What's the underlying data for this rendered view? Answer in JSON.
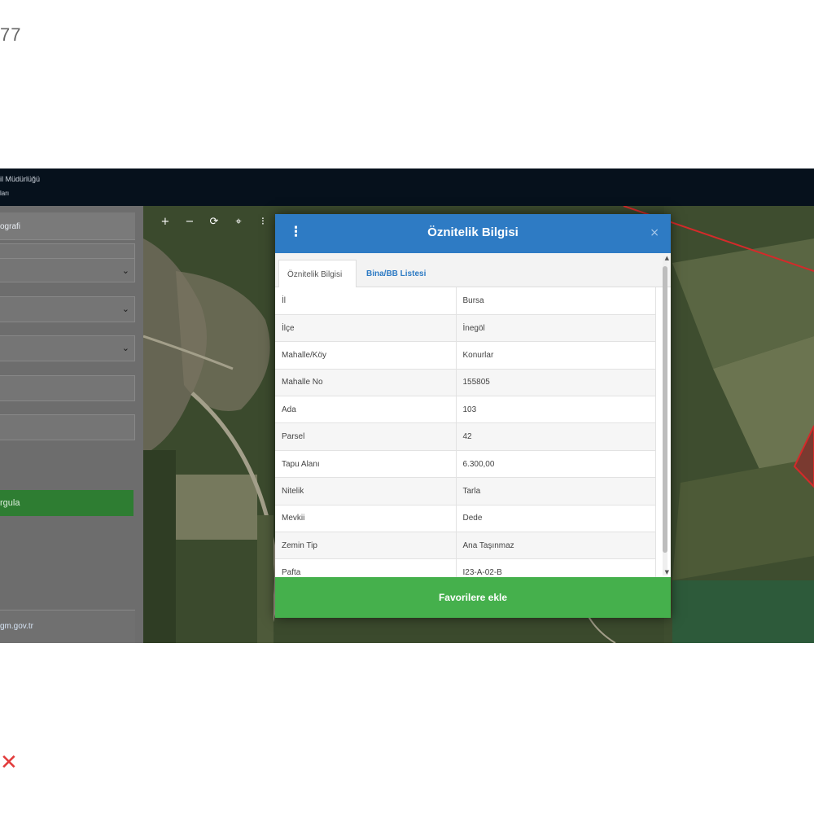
{
  "watermark": {
    "number": "77",
    "mark": "✕"
  },
  "topbar": {
    "line1": "il Müdürlüğü",
    "line2": "ları"
  },
  "sidebar": {
    "header": "ografi",
    "query_button": "rgula",
    "footer_link": "gm.gov.tr",
    "select_chevron": "⌄"
  },
  "map_tools": {
    "zoom_in": "+",
    "zoom_out": "−",
    "refresh": "⟳",
    "locate": "⌖",
    "info": "⁝"
  },
  "modal": {
    "menu_icon": "⋮",
    "title": "Öznitelik Bilgisi",
    "close": "×",
    "tabs": [
      "Öznitelik Bilgisi",
      "Bina/BB Listesi"
    ],
    "rows": [
      [
        "İl",
        "Bursa"
      ],
      [
        "İlçe",
        "İnegöl"
      ],
      [
        "Mahalle/Köy",
        "Konurlar"
      ],
      [
        "Mahalle No",
        "155805"
      ],
      [
        "Ada",
        "103"
      ],
      [
        "Parsel",
        "42"
      ],
      [
        "Tapu Alanı",
        "6.300,00"
      ],
      [
        "Nitelik",
        "Tarla"
      ],
      [
        "Mevkii",
        "Dede"
      ],
      [
        "Zemin Tip",
        "Ana Taşınmaz"
      ],
      [
        "Pafta",
        "I23-A-02-B"
      ]
    ],
    "favorite_button": "Favorilere ekle"
  },
  "colors": {
    "header_blue": "#2e7bc4",
    "favorite_green": "#45b04c",
    "sidebar_green": "#2e7d32",
    "parcel_red": "#d42a2a"
  }
}
